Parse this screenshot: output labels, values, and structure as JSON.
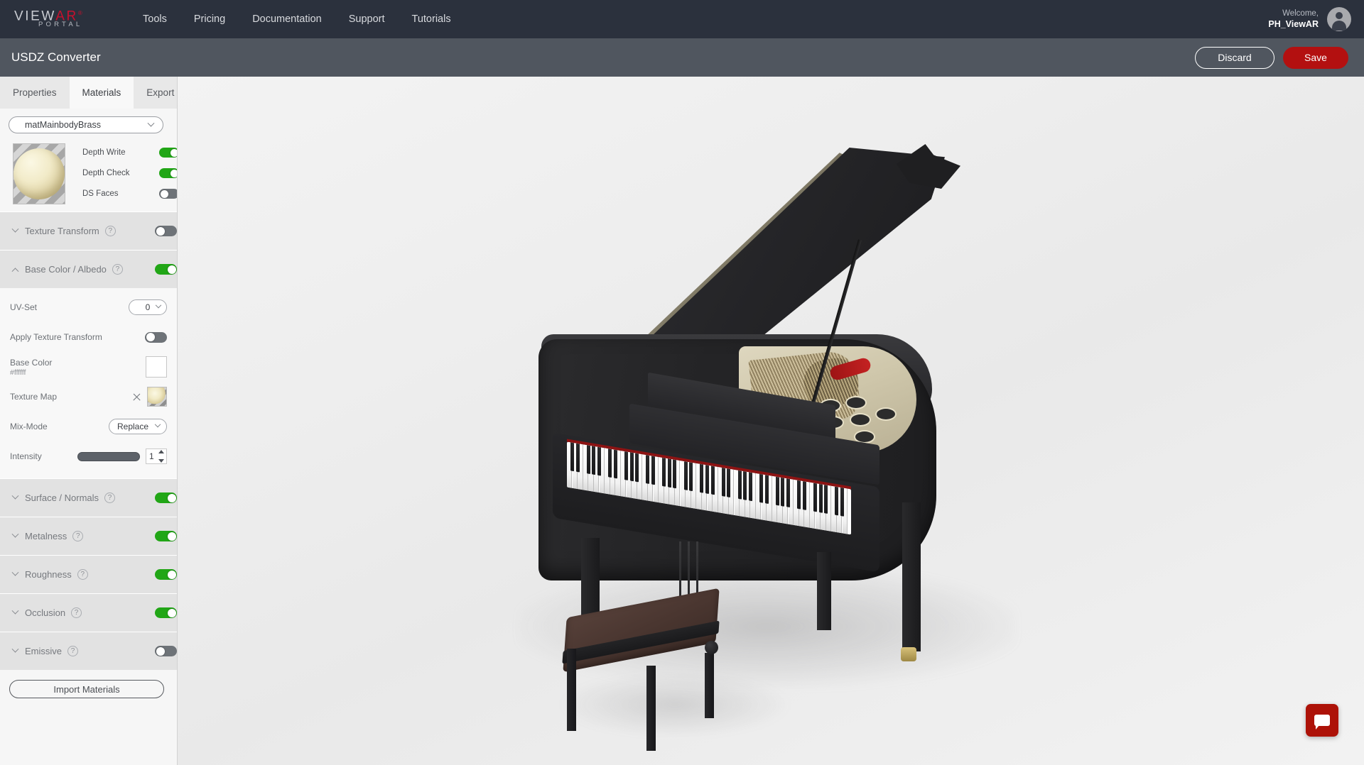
{
  "topnav": {
    "logo": {
      "main": "VIEW",
      "accent": "AR",
      "tm": "®",
      "sub": "PORTAL"
    },
    "links": [
      {
        "label": "Tools"
      },
      {
        "label": "Pricing"
      },
      {
        "label": "Documentation"
      },
      {
        "label": "Support"
      },
      {
        "label": "Tutorials"
      }
    ],
    "welcome_greeting": "Welcome,",
    "welcome_user": "PH_ViewAR",
    "avatar_icon": "user-avatar-icon"
  },
  "subheader": {
    "title": "USDZ Converter",
    "discard_label": "Discard",
    "save_label": "Save",
    "save_color": "#b31010"
  },
  "sidebar": {
    "tabs": [
      {
        "label": "Properties",
        "active": false
      },
      {
        "label": "Materials",
        "active": true
      },
      {
        "label": "Export",
        "active": false
      }
    ],
    "material_select": {
      "value": "matMainbodyBrass",
      "chevron": "chevron-down-icon"
    },
    "preview": {
      "icon": "material-sphere-preview"
    },
    "render_toggles": [
      {
        "label": "Depth Write",
        "on": true
      },
      {
        "label": "Depth Check",
        "on": true
      },
      {
        "label": "DS Faces",
        "on": false
      }
    ],
    "sections": [
      {
        "label": "Texture Transform",
        "on": false,
        "expanded": false,
        "help": "?"
      },
      {
        "label": "Base Color / Albedo",
        "on": true,
        "expanded": true,
        "help": "?"
      },
      {
        "label": "Surface / Normals",
        "on": true,
        "expanded": false,
        "help": "?"
      },
      {
        "label": "Metalness",
        "on": true,
        "expanded": false,
        "help": "?"
      },
      {
        "label": "Roughness",
        "on": true,
        "expanded": false,
        "help": "?"
      },
      {
        "label": "Occlusion",
        "on": true,
        "expanded": false,
        "help": "?"
      },
      {
        "label": "Emissive",
        "on": false,
        "expanded": false,
        "help": "?"
      }
    ],
    "base_color_panel": {
      "uv_set_label": "UV-Set",
      "uv_set_value": "0",
      "apply_texture_transform_label": "Apply Texture Transform",
      "apply_texture_transform_on": false,
      "base_color_label": "Base Color",
      "base_color_value": "#ffffff",
      "texture_map_label": "Texture Map",
      "texture_map_clear_icon": "close-icon",
      "mix_mode_label": "Mix-Mode",
      "mix_mode_value": "Replace",
      "intensity_label": "Intensity",
      "intensity_value": "1"
    },
    "import_button": "Import Materials"
  },
  "viewport": {
    "model_name": "grand-piano-3d-model"
  },
  "chat": {
    "icon": "chat-bubble-icon",
    "color": "#ad1208"
  }
}
